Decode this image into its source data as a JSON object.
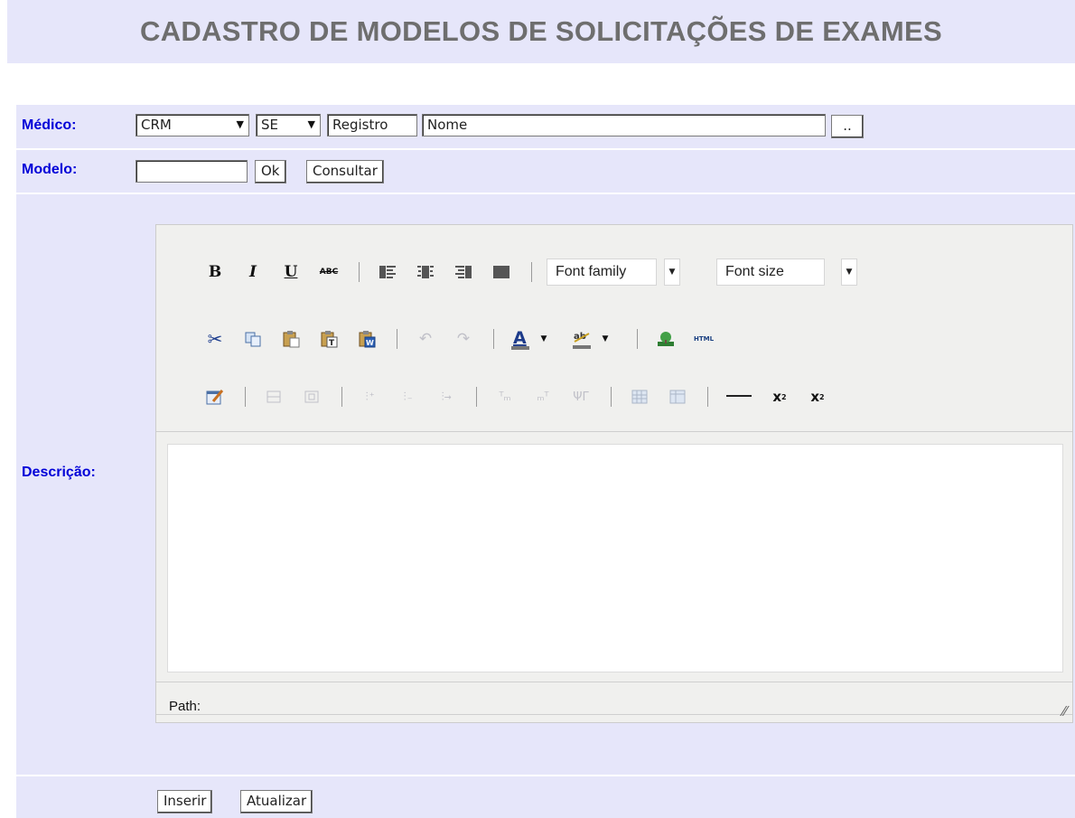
{
  "title": "CADASTRO DE MODELOS DE SOLICITAÇÕES DE EXAMES",
  "form": {
    "medico_label": "Médico:",
    "modelo_label": "Modelo:",
    "descricao_label": "Descrição:",
    "crm_select": "CRM",
    "uf_select": "SE",
    "registro_field": "Registro",
    "nome_field": "Nome",
    "lookup_button": "..",
    "modelo_value": "",
    "ok_button": "Ok",
    "consultar_button": "Consultar"
  },
  "editor": {
    "font_family": "Font family",
    "font_size": "Font size",
    "path_label": "Path:",
    "icons": [
      "bold-icon",
      "italic-icon",
      "underline-icon",
      "strikethrough-icon",
      "align-left-icon",
      "align-center-icon",
      "align-right-icon",
      "align-justify-icon",
      "cut-icon",
      "copy-icon",
      "paste-icon",
      "paste-text-icon",
      "paste-word-icon",
      "undo-icon",
      "redo-icon",
      "text-color-icon",
      "highlight-color-icon",
      "image-icon",
      "html-icon",
      "edit-cell-icon",
      "row-insert-icon",
      "merge-cells-icon",
      "indent-icon",
      "outdent-icon",
      "list-icon",
      "subscript-m-icon",
      "superscript-m-icon",
      "table-props-icon",
      "table-icon",
      "table-delete-icon",
      "horizontal-rule-icon",
      "subscript-icon",
      "superscript-icon"
    ]
  },
  "actions": {
    "inserir_button": "Inserir",
    "atualizar_button": "Atualizar"
  }
}
